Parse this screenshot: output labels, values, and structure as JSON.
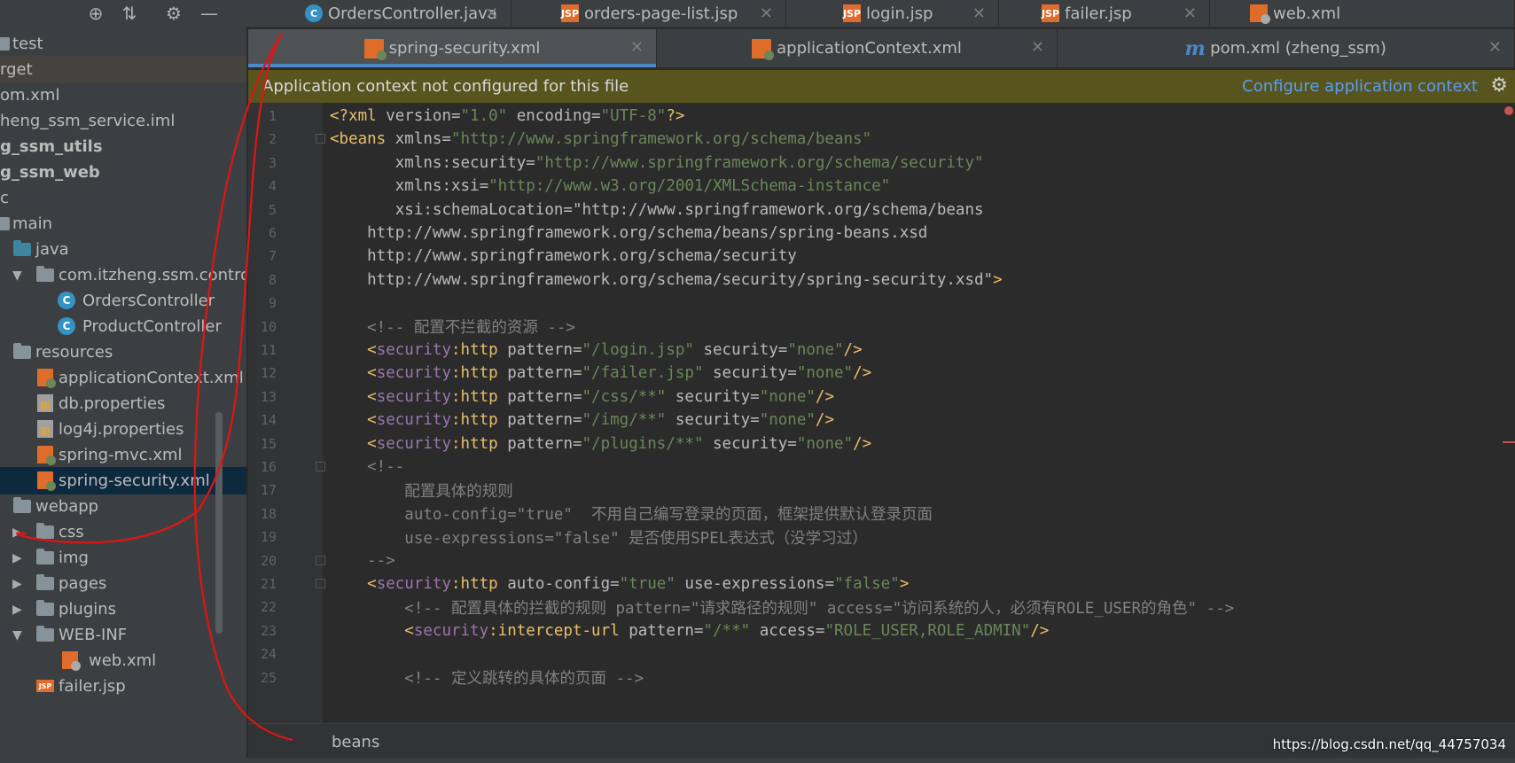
{
  "toolbar": {
    "icons": [
      "crosshair-icon",
      "collapse-icon",
      "gear-icon",
      "minimize-icon"
    ]
  },
  "tabs_row1": [
    {
      "label": "OrdersController.java",
      "icon": "java-class-icon"
    },
    {
      "label": "orders-page-list.jsp",
      "icon": "jsp-icon"
    },
    {
      "label": "login.jsp",
      "icon": "jsp-icon"
    },
    {
      "label": "failer.jsp",
      "icon": "jsp-icon"
    },
    {
      "label": "web.xml",
      "icon": "web-xml-icon"
    }
  ],
  "tabs_row2": [
    {
      "label": "spring-security.xml",
      "icon": "spring-xml-icon",
      "active": true
    },
    {
      "label": "applicationContext.xml",
      "icon": "spring-xml-icon"
    },
    {
      "label": "pom.xml (zheng_ssm)",
      "icon": "maven-icon"
    }
  ],
  "tab_close": "✕",
  "maven_letter": "m",
  "banner": {
    "message": "Application context not configured for this file",
    "link": "Configure application context"
  },
  "tree": [
    {
      "label": "test",
      "icon": "folder-icon"
    },
    {
      "label": "rget",
      "icon": "none"
    },
    {
      "label": "om.xml",
      "icon": "none"
    },
    {
      "label": "heng_ssm_service.iml",
      "icon": "none"
    },
    {
      "label": "g_ssm_utils",
      "icon": "none"
    },
    {
      "label": "g_ssm_web",
      "icon": "none"
    },
    {
      "label": "c",
      "icon": "none"
    },
    {
      "label": "main",
      "icon": "folder-icon"
    },
    {
      "label": "java",
      "icon": "source-folder-icon"
    },
    {
      "label": "com.itzheng.ssm.controlle",
      "icon": "package-icon"
    },
    {
      "label": "OrdersController",
      "icon": "class-icon"
    },
    {
      "label": "ProductController",
      "icon": "class-icon"
    },
    {
      "label": "resources",
      "icon": "resources-folder-icon"
    },
    {
      "label": "applicationContext.xml",
      "icon": "spring-xml-icon"
    },
    {
      "label": "db.properties",
      "icon": "properties-icon"
    },
    {
      "label": "log4j.properties",
      "icon": "properties-icon"
    },
    {
      "label": "spring-mvc.xml",
      "icon": "spring-xml-icon"
    },
    {
      "label": "spring-security.xml",
      "icon": "spring-xml-icon"
    },
    {
      "label": "webapp",
      "icon": "folder-icon"
    },
    {
      "label": "css",
      "icon": "folder-icon"
    },
    {
      "label": "img",
      "icon": "folder-icon"
    },
    {
      "label": "pages",
      "icon": "folder-icon"
    },
    {
      "label": "plugins",
      "icon": "folder-icon"
    },
    {
      "label": "WEB-INF",
      "icon": "folder-icon"
    },
    {
      "label": "web.xml",
      "icon": "web-xml-icon"
    },
    {
      "label": "failer.jsp",
      "icon": "jsp-icon"
    }
  ],
  "class_letter": "C",
  "jsp_badge": "JSP",
  "line_numbers": [
    "1",
    "2",
    "3",
    "4",
    "5",
    "6",
    "7",
    "8",
    "9",
    "10",
    "11",
    "12",
    "13",
    "14",
    "15",
    "16",
    "17",
    "18",
    "19",
    "20",
    "21",
    "22",
    "23",
    "24",
    "25"
  ],
  "code_lines": [
    "<?xml version=\"1.0\" encoding=\"UTF-8\"?>",
    "<beans xmlns=\"http://www.springframework.org/schema/beans\"",
    "       xmlns:security=\"http://www.springframework.org/schema/security\"",
    "       xmlns:xsi=\"http://www.w3.org/2001/XMLSchema-instance\"",
    "       xsi:schemaLocation=\"http://www.springframework.org/schema/beans",
    "    http://www.springframework.org/schema/beans/spring-beans.xsd",
    "    http://www.springframework.org/schema/security",
    "    http://www.springframework.org/schema/security/spring-security.xsd\">",
    "",
    "    <!-- 配置不拦截的资源 -->",
    "    <security:http pattern=\"/login.jsp\" security=\"none\"/>",
    "    <security:http pattern=\"/failer.jsp\" security=\"none\"/>",
    "    <security:http pattern=\"/css/**\" security=\"none\"/>",
    "    <security:http pattern=\"/img/**\" security=\"none\"/>",
    "    <security:http pattern=\"/plugins/**\" security=\"none\"/>",
    "    <!--",
    "        配置具体的规则",
    "        auto-config=\"true\"  不用自己编写登录的页面，框架提供默认登录页面",
    "        use-expressions=\"false\" 是否使用SPEL表达式（没学习过）",
    "    -->",
    "    <security:http auto-config=\"true\" use-expressions=\"false\">",
    "        <!-- 配置具体的拦截的规则 pattern=\"请求路径的规则\" access=\"访问系统的人，必须有ROLE_USER的角色\" -->",
    "        <security:intercept-url pattern=\"/**\" access=\"ROLE_USER,ROLE_ADMIN\"/>",
    "",
    "        <!-- 定义跳转的具体的页面 -->"
  ],
  "breadcrumb": "beans",
  "watermark": "https://blog.csdn.net/qq_44757034",
  "colors": {
    "tag": "#e8bf6a",
    "namespace": "#9876aa",
    "value": "#6a8759",
    "comment": "#808080",
    "annotation_ink": "#e01414"
  }
}
